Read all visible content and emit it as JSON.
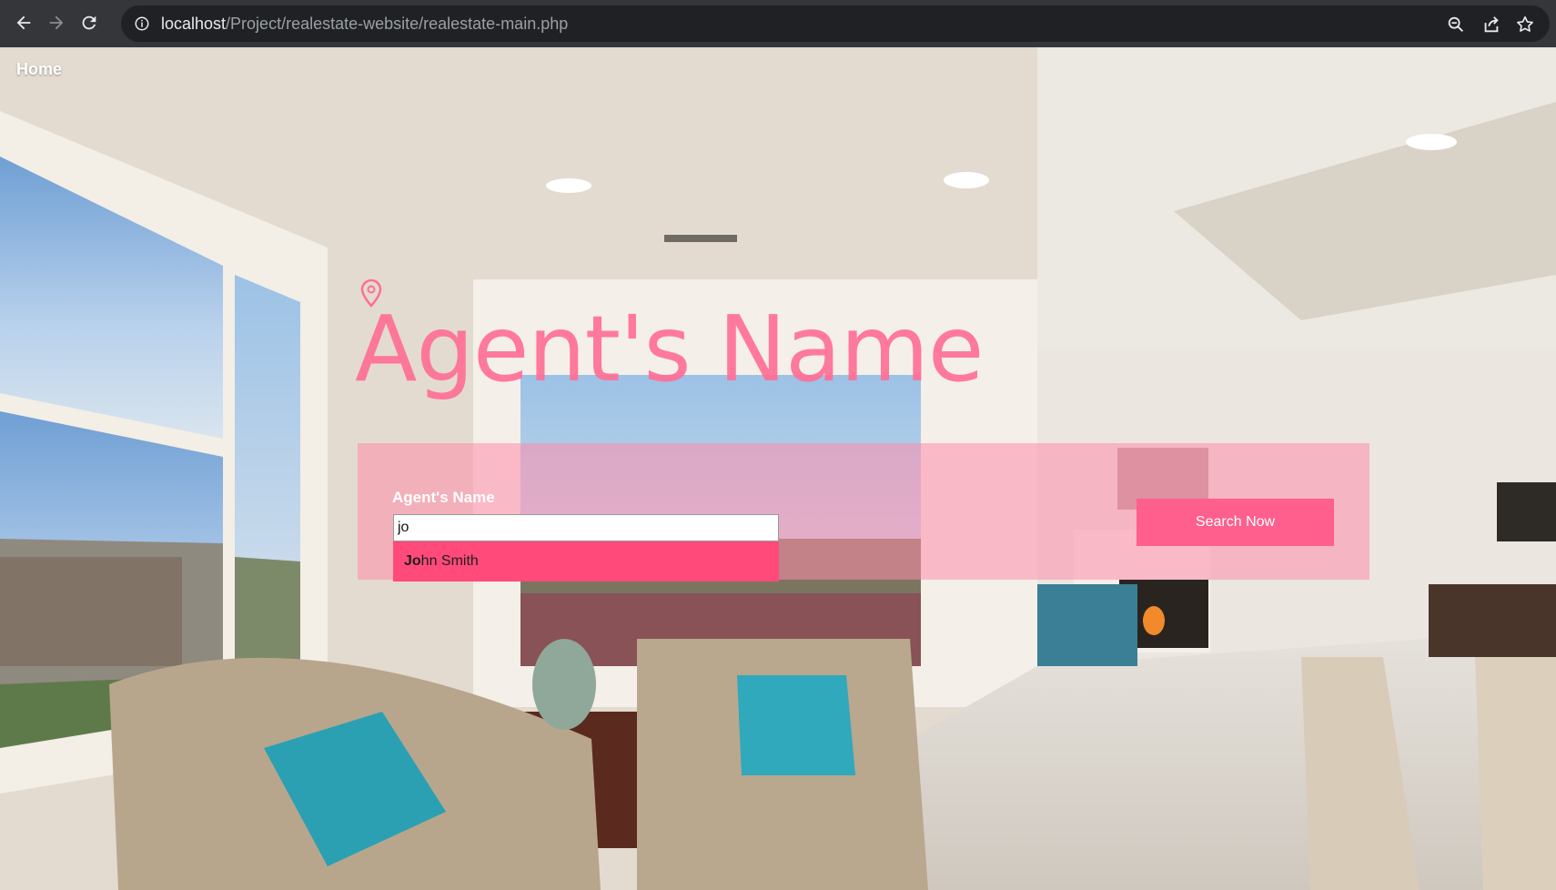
{
  "browser": {
    "url_host": "localhost",
    "url_path": "/Project/realestate-website/realestate-main.php",
    "icons": [
      "back-icon",
      "forward-icon",
      "reload-icon",
      "info-icon",
      "zoom-icon",
      "share-icon",
      "bookmark-star-icon"
    ]
  },
  "nav": {
    "home_label": "Home"
  },
  "hero": {
    "title": "Agent's Name"
  },
  "search": {
    "label": "Agent's Name",
    "input_value": "jo",
    "suggestions": [
      {
        "match": "Jo",
        "rest": "hn Smith"
      }
    ],
    "button_label": "Search Now"
  },
  "colors": {
    "accent": "#ff4a7a",
    "title": "#ff6f96",
    "panel": "#ff8caa",
    "button": "#ff5f8d"
  }
}
